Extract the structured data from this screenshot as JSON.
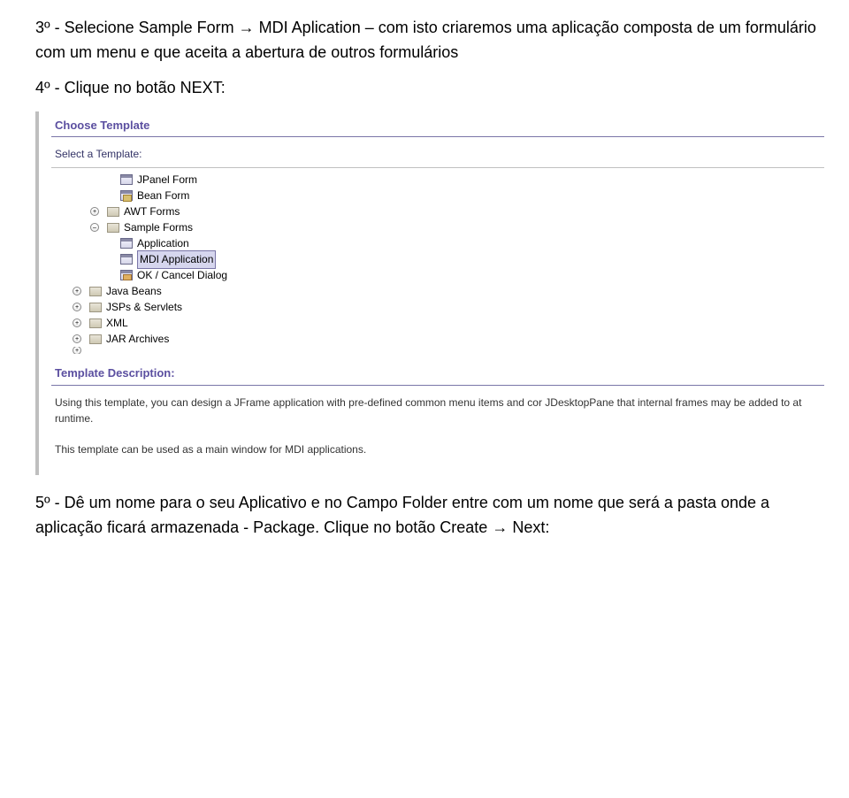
{
  "paragraphs": {
    "p1a": "3º - Selecione Sample Form ",
    "arrow1": "→",
    "p1b": " MDI Aplication – com isto criaremos uma aplicação composta de um formulário com um menu e que aceita a abertura de outros formulários",
    "p2": "4º - Clique no botão NEXT:",
    "p3": "5º - Dê um nome para o seu Aplicativo e no Campo Folder entre com um nome que será a pasta onde a aplicação ficará armazenada - Package. Clique no botão Create ",
    "arrow2": "→",
    "p3b": " Next:"
  },
  "sc": {
    "header": "Choose Template",
    "select_label": "Select a Template:",
    "tree": {
      "jpanel": "JPanel Form",
      "bean": "Bean Form",
      "awt": "AWT Forms",
      "sample": "Sample Forms",
      "application": "Application",
      "mdi": "MDI Application",
      "okcancel": "OK / Cancel Dialog",
      "javabeans": "Java Beans",
      "jsps": "JSPs & Servlets",
      "xml": "XML",
      "jar": "JAR Archives"
    },
    "desc_header": "Template Description:",
    "desc1": "Using this template, you can design a JFrame application with pre-defined common menu items and cor JDesktopPane that internal frames may be added to at runtime.",
    "desc2": "This template can be used as a main window for MDI applications."
  }
}
